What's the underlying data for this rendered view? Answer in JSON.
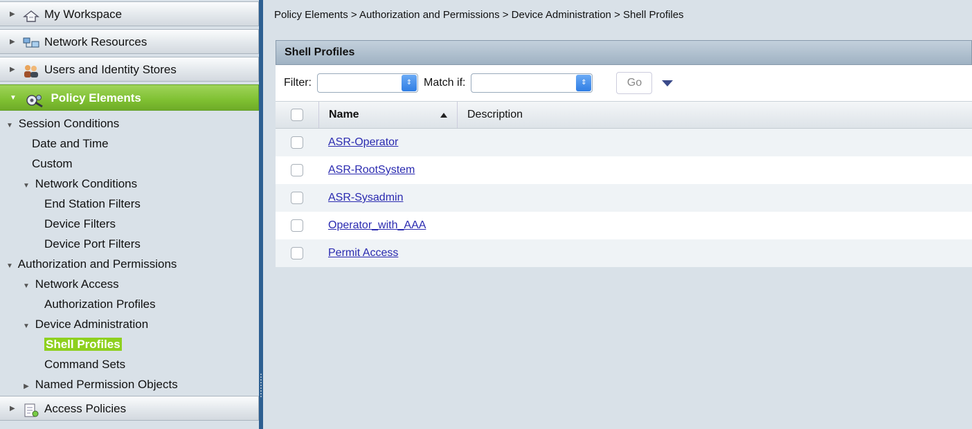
{
  "sidebar": {
    "drawers_top": [
      {
        "label": "My Workspace",
        "icon": "workspace-icon"
      },
      {
        "label": "Network Resources",
        "icon": "network-resources-icon"
      },
      {
        "label": "Users and Identity Stores",
        "icon": "users-icon"
      }
    ],
    "active_drawer": {
      "label": "Policy Elements",
      "icon": "policy-elements-icon"
    },
    "tree": [
      {
        "label": "Session Conditions",
        "level": 0,
        "arrow": "down"
      },
      {
        "label": "Date and Time",
        "level": 1,
        "arrow": ""
      },
      {
        "label": "Custom",
        "level": 1,
        "arrow": ""
      },
      {
        "label": "Network Conditions",
        "level": 1,
        "arrow": "down"
      },
      {
        "label": "End Station Filters",
        "level": 2,
        "arrow": ""
      },
      {
        "label": "Device Filters",
        "level": 2,
        "arrow": ""
      },
      {
        "label": "Device Port Filters",
        "level": 2,
        "arrow": ""
      },
      {
        "label": "Authorization and Permissions",
        "level": 0,
        "arrow": "down"
      },
      {
        "label": "Network Access",
        "level": 1,
        "arrow": "down"
      },
      {
        "label": "Authorization Profiles",
        "level": 2,
        "arrow": ""
      },
      {
        "label": "Device Administration",
        "level": 1,
        "arrow": "down"
      },
      {
        "label": "Shell Profiles",
        "level": 2,
        "arrow": "",
        "selected": true
      },
      {
        "label": "Command Sets",
        "level": 2,
        "arrow": ""
      },
      {
        "label": "Named Permission Objects",
        "level": 1,
        "arrow": "right"
      }
    ],
    "drawers_bottom": [
      {
        "label": "Access Policies",
        "icon": "access-policies-icon"
      }
    ]
  },
  "breadcrumb": "Policy Elements > Authorization and Permissions > Device Administration > Shell Profiles",
  "panel": {
    "title": "Shell Profiles",
    "filter_label": "Filter:",
    "filter_value": "",
    "match_label": "Match if:",
    "match_value": "",
    "go_label": "Go"
  },
  "table": {
    "columns": {
      "name": "Name",
      "description": "Description"
    },
    "rows": [
      {
        "name": "ASR-Operator",
        "description": ""
      },
      {
        "name": "ASR-RootSystem",
        "description": ""
      },
      {
        "name": "ASR-Sysadmin",
        "description": ""
      },
      {
        "name": "Operator_with_AAA",
        "description": ""
      },
      {
        "name": "Permit Access",
        "description": ""
      }
    ]
  },
  "colors": {
    "accent_green": "#8ed01e",
    "link_blue": "#2a2ab0",
    "splitter_blue": "#2d5f91"
  }
}
